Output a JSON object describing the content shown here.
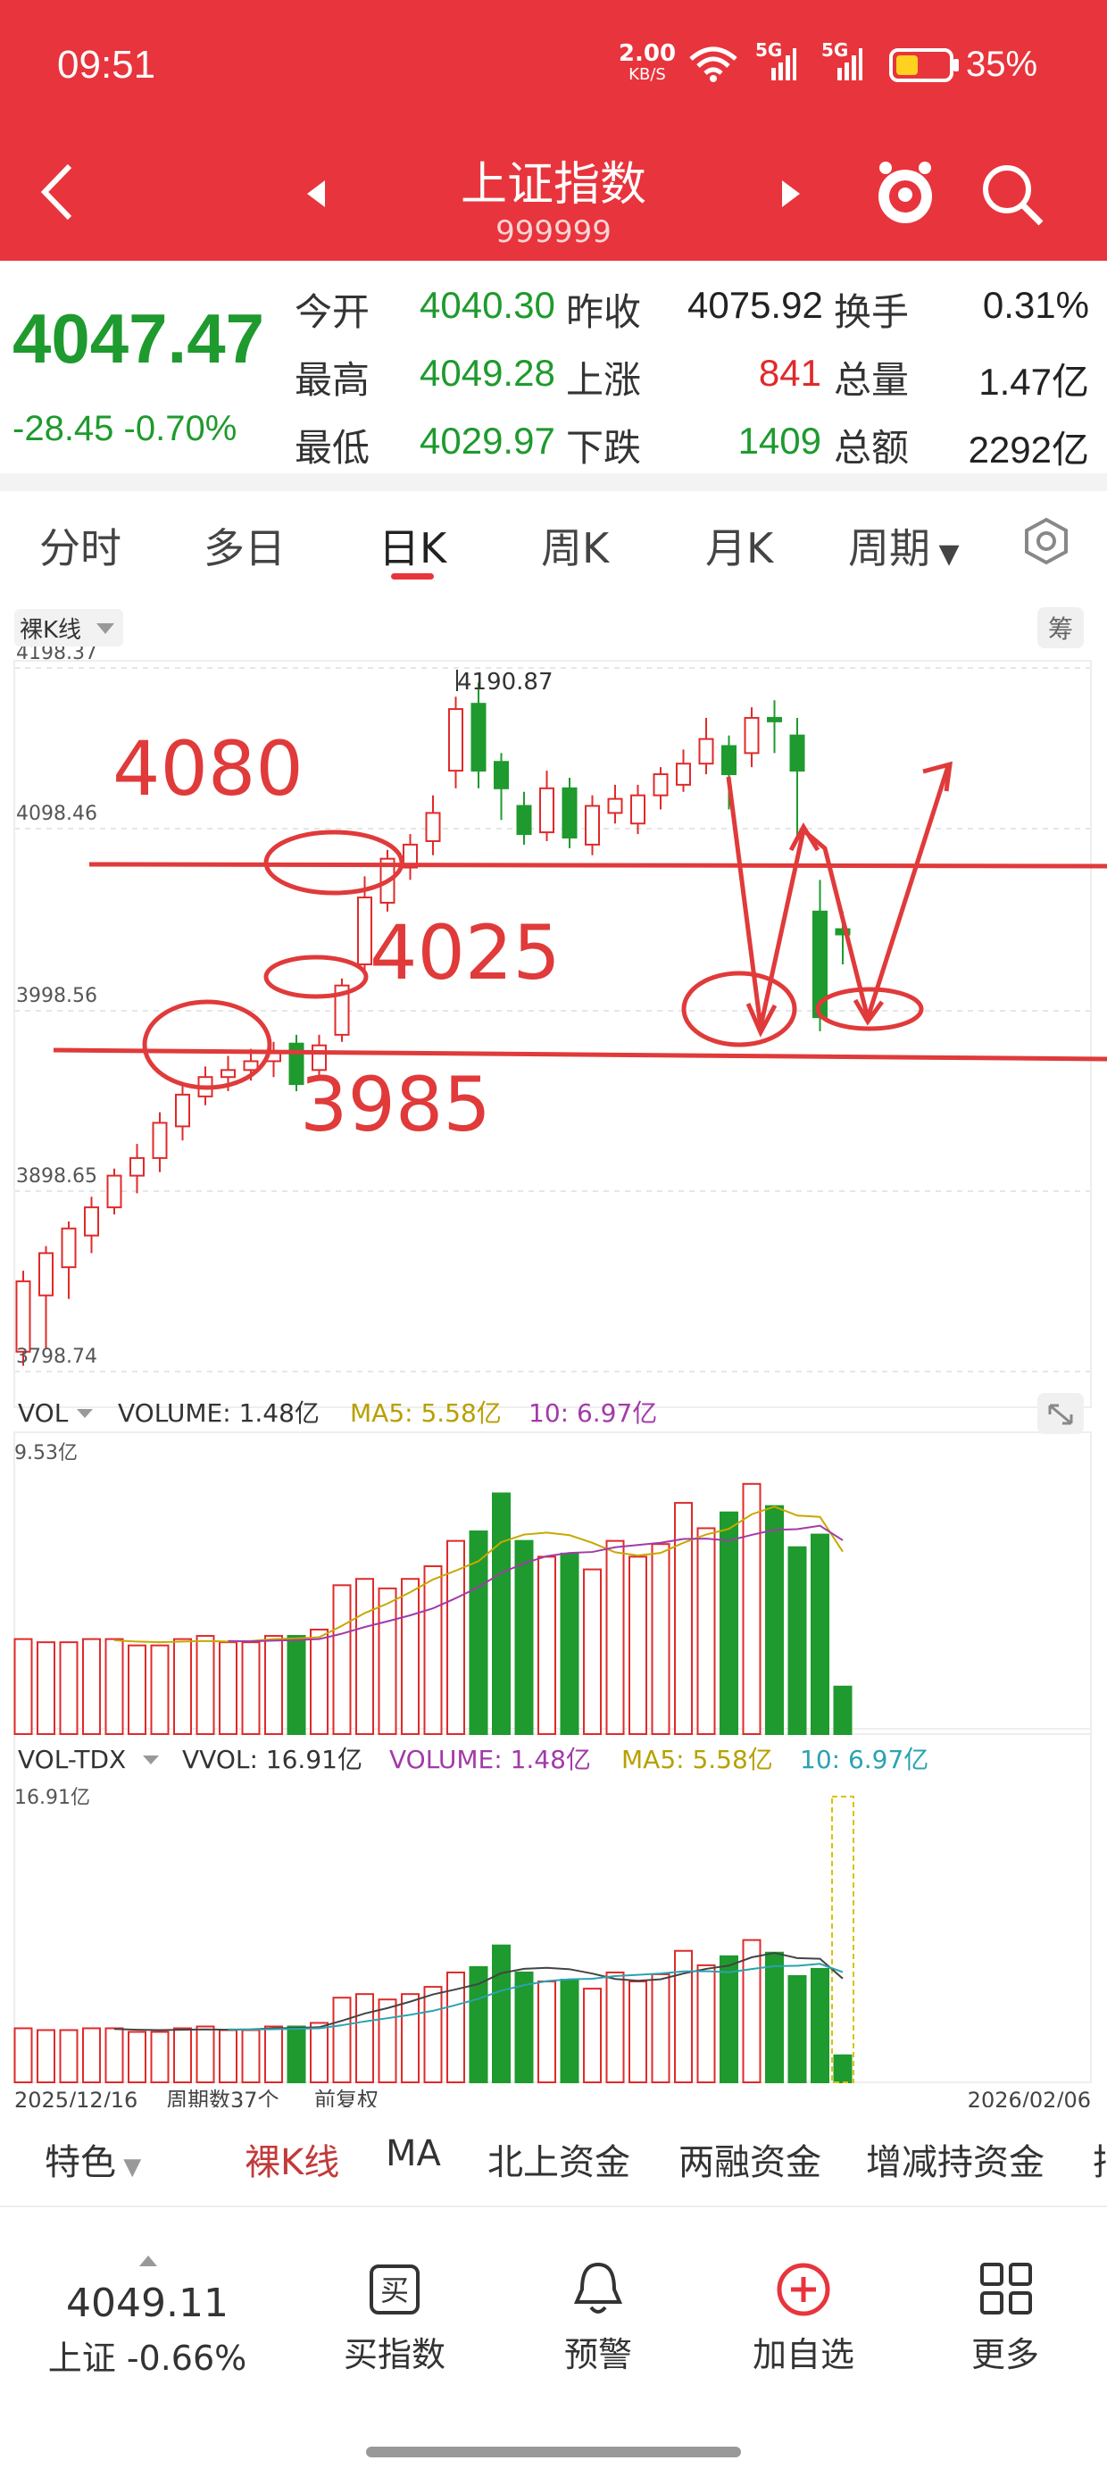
{
  "status_bar": {
    "time": "09:51",
    "net_speed": "2.00",
    "net_unit": "KB/S",
    "signal1": "5G",
    "signal2": "5G",
    "battery": "35%"
  },
  "header": {
    "title": "上证指数",
    "code": "999999"
  },
  "quote": {
    "price": "4047.47",
    "change": "-28.45",
    "change_pct": "-0.70%",
    "rows": [
      {
        "l1": "今开",
        "v1": "4040.30",
        "l2": "昨收",
        "v2": "4075.92",
        "l3": "换手",
        "v3": "0.31%"
      },
      {
        "l1": "最高",
        "v1": "4049.28",
        "l2": "上涨",
        "v2": "841",
        "l3": "总量",
        "v3": "1.47亿"
      },
      {
        "l1": "最低",
        "v1": "4029.97",
        "l2": "下跌",
        "v2": "1409",
        "l3": "总额",
        "v3": "2292亿"
      }
    ]
  },
  "tabs": [
    "分时",
    "多日",
    "日K",
    "周K",
    "月K",
    "周期"
  ],
  "chart": {
    "mode_label": "裸K线",
    "side_button": "筹",
    "y_ticks": [
      "4198.37",
      "4098.46",
      "3998.56",
      "3898.65",
      "3798.74"
    ],
    "peak_label": "4190.87",
    "annotations": [
      "4080",
      "4025",
      "3985"
    ],
    "vol_label": "VOL",
    "vol_volume": "VOLUME: 1.48亿",
    "vol_ma5": "MA5: 5.58亿",
    "vol_10": "10: 6.97亿",
    "vol_max": "9.53亿",
    "tdx_label": "VOL-TDX",
    "tdx_vvol": "VVOL: 16.91亿",
    "tdx_volume": "VOLUME: 1.48亿",
    "tdx_ma5": "MA5: 5.58亿",
    "tdx_10": "10: 6.97亿",
    "tdx_max": "16.91亿",
    "date_start": "2025/12/16",
    "period_count": "周期数37个",
    "adjust": "前复权",
    "date_end": "2026/02/06"
  },
  "bottom_tabs": [
    "特色",
    "裸K线",
    "MA",
    "北上资金",
    "两融资金",
    "增减持资金",
    "把"
  ],
  "footer": {
    "index_value": "4049.11",
    "index_name": "上证 -0.66%",
    "buy": "买指数",
    "buy_icon_text": "买",
    "alert": "预警",
    "add": "加自选",
    "more": "更多"
  },
  "colors": {
    "header_red": "#e8343c",
    "up_red": "#e02a2a",
    "down_green": "#1e9a2e",
    "annotation_red": "#e03a3a"
  }
}
